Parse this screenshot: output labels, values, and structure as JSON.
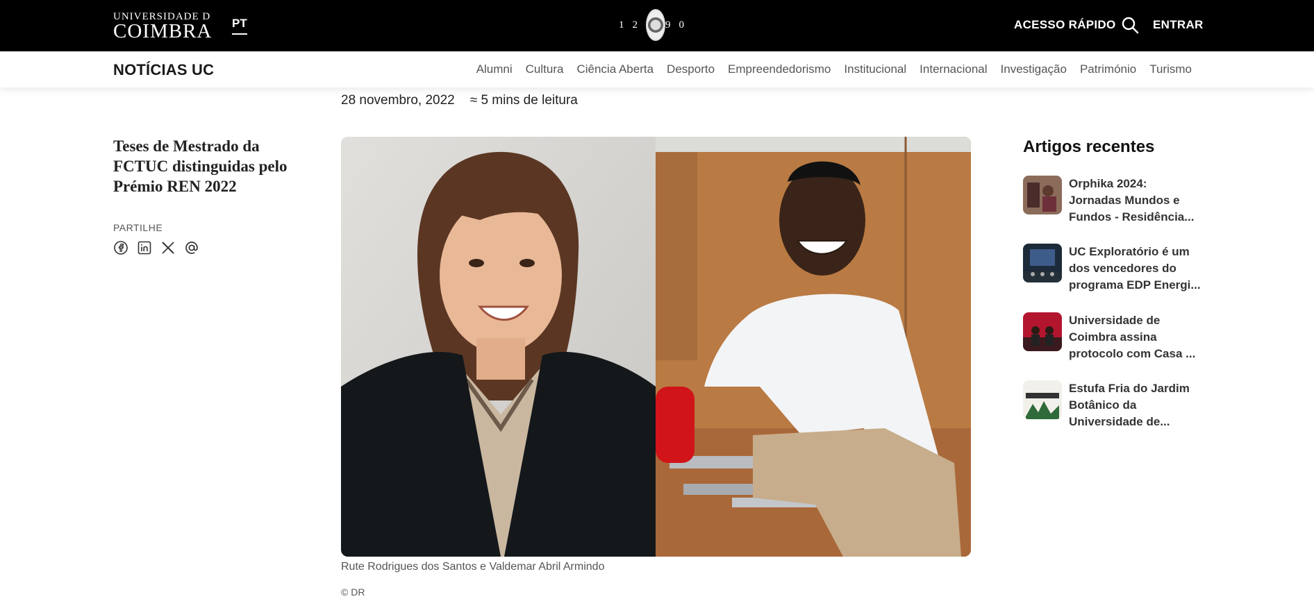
{
  "header": {
    "logo_line1": "UNIVERSIDADE D",
    "logo_line2": "COIMBRA",
    "language": "PT",
    "seal_year_left": "12",
    "seal_year_right": "90",
    "quick_access": "ACESSO RÁPIDO",
    "search_icon": "search-icon",
    "login": "ENTRAR"
  },
  "subnav": {
    "title": "NOTÍCIAS UC",
    "links": [
      "Alumni",
      "Cultura",
      "Ciência Aberta",
      "Desporto",
      "Empreendedorismo",
      "Institucional",
      "Internacional",
      "Investigação",
      "Património",
      "Turismo"
    ]
  },
  "article": {
    "date": "28 novembro, 2022",
    "reading_time": "≈ 5 mins de leitura",
    "title": "Teses de Mestrado da FCTUC distinguidas pelo Prémio REN 2022",
    "share_label": "PARTILHE",
    "share_icons": [
      "facebook-icon",
      "linkedin-icon",
      "x-icon",
      "email-icon"
    ],
    "image_caption": "Rute Rodrigues dos Santos e Valdemar Abril Armindo",
    "image_credit": "© DR"
  },
  "sidebar": {
    "title": "Artigos recentes",
    "items": [
      {
        "title": "Orphika 2024: Jornadas Mundos e Fundos - Residência..."
      },
      {
        "title": "UC Exploratório é um dos vencedores do programa EDP Energi..."
      },
      {
        "title": "Universidade de Coimbra assina protocolo com Casa ..."
      },
      {
        "title": "Estufa Fria do Jardim Botânico da Universidade de..."
      }
    ]
  },
  "colors": {
    "topbar": "#000000",
    "text": "#1a1a1a",
    "nav_link": "#555555"
  }
}
